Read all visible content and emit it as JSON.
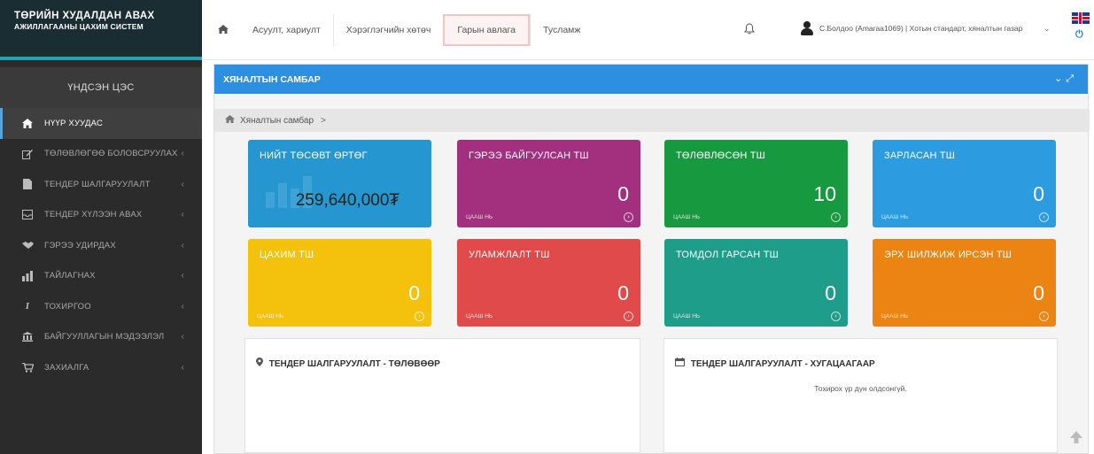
{
  "brand": {
    "line1": "ТӨРИЙН ХУДАЛДАН АВАХ",
    "line2": "АЖИЛЛАГААНЫ ЦАХИМ СИСТЕМ"
  },
  "sidebar": {
    "header": "ҮНДСЭН ЦЭС",
    "items": [
      {
        "label": "НҮҮР ХУУДАС",
        "icon": "home-icon"
      },
      {
        "label": "ТӨЛӨВЛӨГӨӨ БОЛОВСРУУЛАХ",
        "icon": "edit-icon"
      },
      {
        "label": "ТЕНДЕР ШАЛГАРУУЛАЛТ",
        "icon": "document-icon"
      },
      {
        "label": "ТЕНДЕР ХҮЛЭЭН АВАХ",
        "icon": "inbox-icon"
      },
      {
        "label": "ГЭРЭЭ УДИРДАХ",
        "icon": "handshake-icon"
      },
      {
        "label": "ТАЙЛАГНАХ",
        "icon": "report-icon"
      },
      {
        "label": "ТОХИРГОО",
        "icon": "info-icon"
      },
      {
        "label": "БАЙГУУЛЛАГЫН МЭДЭЭЛЭЛ",
        "icon": "building-icon"
      },
      {
        "label": "ЗАХИАЛГА",
        "icon": "cart-icon"
      }
    ]
  },
  "topnav": {
    "tabs": [
      "Асуулт, хариулт",
      "Хэрэглэгчийн хөтөч",
      "Гарын авлага",
      "Тусламж"
    ],
    "user": "С.Болдоо (Amaraa1069) | Хотын стандарт, хяналтын газар"
  },
  "panel": {
    "title": "ХЯНАЛТЫН САМБАР",
    "breadcrumb": "Хяналтын самбар",
    "breadcrumb_sep": ">"
  },
  "cards": [
    {
      "title": "НИЙТ ТӨСӨВТ ӨРТӨГ",
      "value": "259,640,000₮",
      "more": "",
      "color": "#2596cf"
    },
    {
      "title": "ГЭРЭЭ БАЙГУУЛСАН ТШ",
      "value": "0",
      "more": "ЦААШ НЬ",
      "color": "#a3307e"
    },
    {
      "title": "ТӨЛӨВЛӨСӨН ТШ",
      "value": "10",
      "more": "ЦААШ НЬ",
      "color": "#179a3f"
    },
    {
      "title": "ЗАРЛАСАН ТШ",
      "value": "0",
      "more": "ЦААШ НЬ",
      "color": "#2d9be0"
    },
    {
      "title": "ЦАХИМ ТШ",
      "value": "0",
      "more": "ЦААШ НЬ",
      "color": "#f4c20d"
    },
    {
      "title": "УЛАМЖЛАЛТ ТШ",
      "value": "0",
      "more": "ЦААШ НЬ",
      "color": "#e04a4a"
    },
    {
      "title": "ТОМДОЛ ГАРСАН ТШ",
      "value": "0",
      "more": "ЦААШ НЬ",
      "color": "#1e9e8a"
    },
    {
      "title": "ЭРХ ШИЛЖИЖ ИРСЭН ТШ",
      "value": "0",
      "more": "ЦААШ НЬ",
      "color": "#ec8413"
    }
  ],
  "boxes": [
    {
      "title": "ТЕНДЕР ШАЛГАРУУЛАЛТ - ТӨЛӨВӨӨР",
      "icon": "map-pin-icon",
      "empty": ""
    },
    {
      "title": "ТЕНДЕР ШАЛГАРУУЛАЛТ - ХУГАЦААГААР",
      "icon": "calendar-icon",
      "empty": "Тохирох үр дүн олдсонгүй."
    }
  ]
}
